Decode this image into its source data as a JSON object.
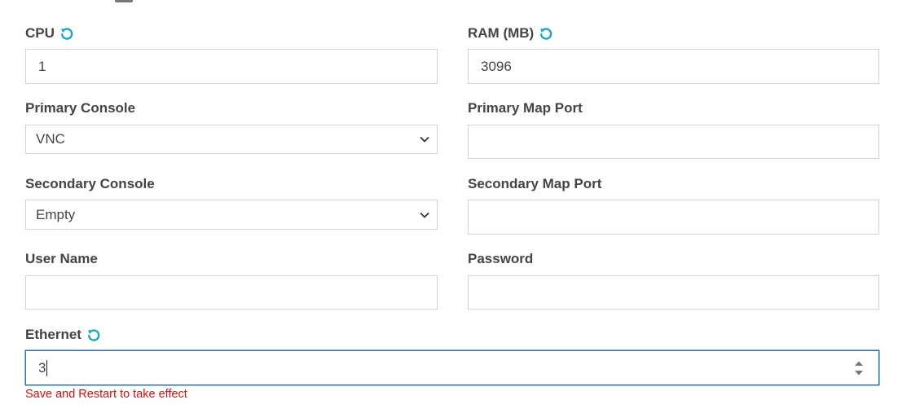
{
  "form": {
    "cpu": {
      "label": "CPU",
      "value": "1",
      "reset_icon": "reset-icon"
    },
    "ram": {
      "label": "RAM (MB)",
      "value": "3096",
      "reset_icon": "reset-icon"
    },
    "primary_console": {
      "label": "Primary Console",
      "selected": "VNC"
    },
    "primary_map_port": {
      "label": "Primary Map Port",
      "value": ""
    },
    "secondary_console": {
      "label": "Secondary Console",
      "selected": "Empty"
    },
    "secondary_map_port": {
      "label": "Secondary Map Port",
      "value": ""
    },
    "user_name": {
      "label": "User Name",
      "value": ""
    },
    "password": {
      "label": "Password",
      "value": ""
    },
    "ethernet": {
      "label": "Ethernet",
      "value": "3",
      "reset_icon": "reset-icon",
      "hint": "Save and Restart to take effect"
    }
  },
  "colors": {
    "accent": "#1aa7c4",
    "error": "#cc1111",
    "focus_border": "#2a6fb0",
    "border": "#d3d3d3",
    "label": "#444444"
  }
}
